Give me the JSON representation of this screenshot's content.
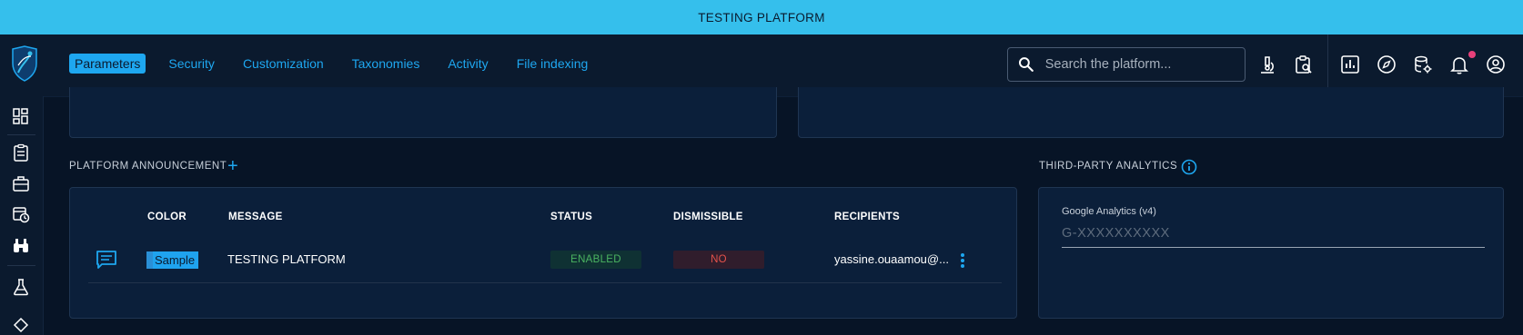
{
  "banner": {
    "text": "TESTING PLATFORM"
  },
  "nav": {
    "items": [
      {
        "label": "Parameters",
        "active": true
      },
      {
        "label": "Security"
      },
      {
        "label": "Customization"
      },
      {
        "label": "Taxonomies"
      },
      {
        "label": "Activity"
      },
      {
        "label": "File indexing"
      }
    ]
  },
  "search": {
    "placeholder": "Search the platform..."
  },
  "colors": {
    "banner": "#35bfec",
    "accent": "#1ea7f0",
    "background": "#071426",
    "panel": "#0b1f3a",
    "enabled_text": "#4bb461",
    "no_text": "#e4524b",
    "notification_dot": "#e8407a"
  },
  "toolbar_icons": [
    "microscope-icon",
    "clipboard-search-icon",
    "chart-icon",
    "compass-icon",
    "database-gear-icon",
    "bell-icon",
    "user-circle-icon"
  ],
  "sidebar_icons": [
    "dashboard-icon",
    "clipboard-icon",
    "briefcase-icon",
    "calendar-clock-icon",
    "binoculars-icon",
    "flask-icon"
  ],
  "announcement": {
    "title": "PLATFORM ANNOUNCEMENT",
    "columns": {
      "color": "COLOR",
      "message": "MESSAGE",
      "status": "STATUS",
      "dismissible": "DISMISSIBLE",
      "recipients": "RECIPIENTS"
    },
    "rows": [
      {
        "color_label": "Sample",
        "message": "TESTING PLATFORM",
        "status": "ENABLED",
        "dismissible": "NO",
        "recipients": "yassine.ouaamou@..."
      }
    ]
  },
  "analytics": {
    "title": "THIRD-PARTY ANALYTICS",
    "field_label": "Google Analytics (v4)",
    "field_placeholder": "G-XXXXXXXXXX"
  }
}
